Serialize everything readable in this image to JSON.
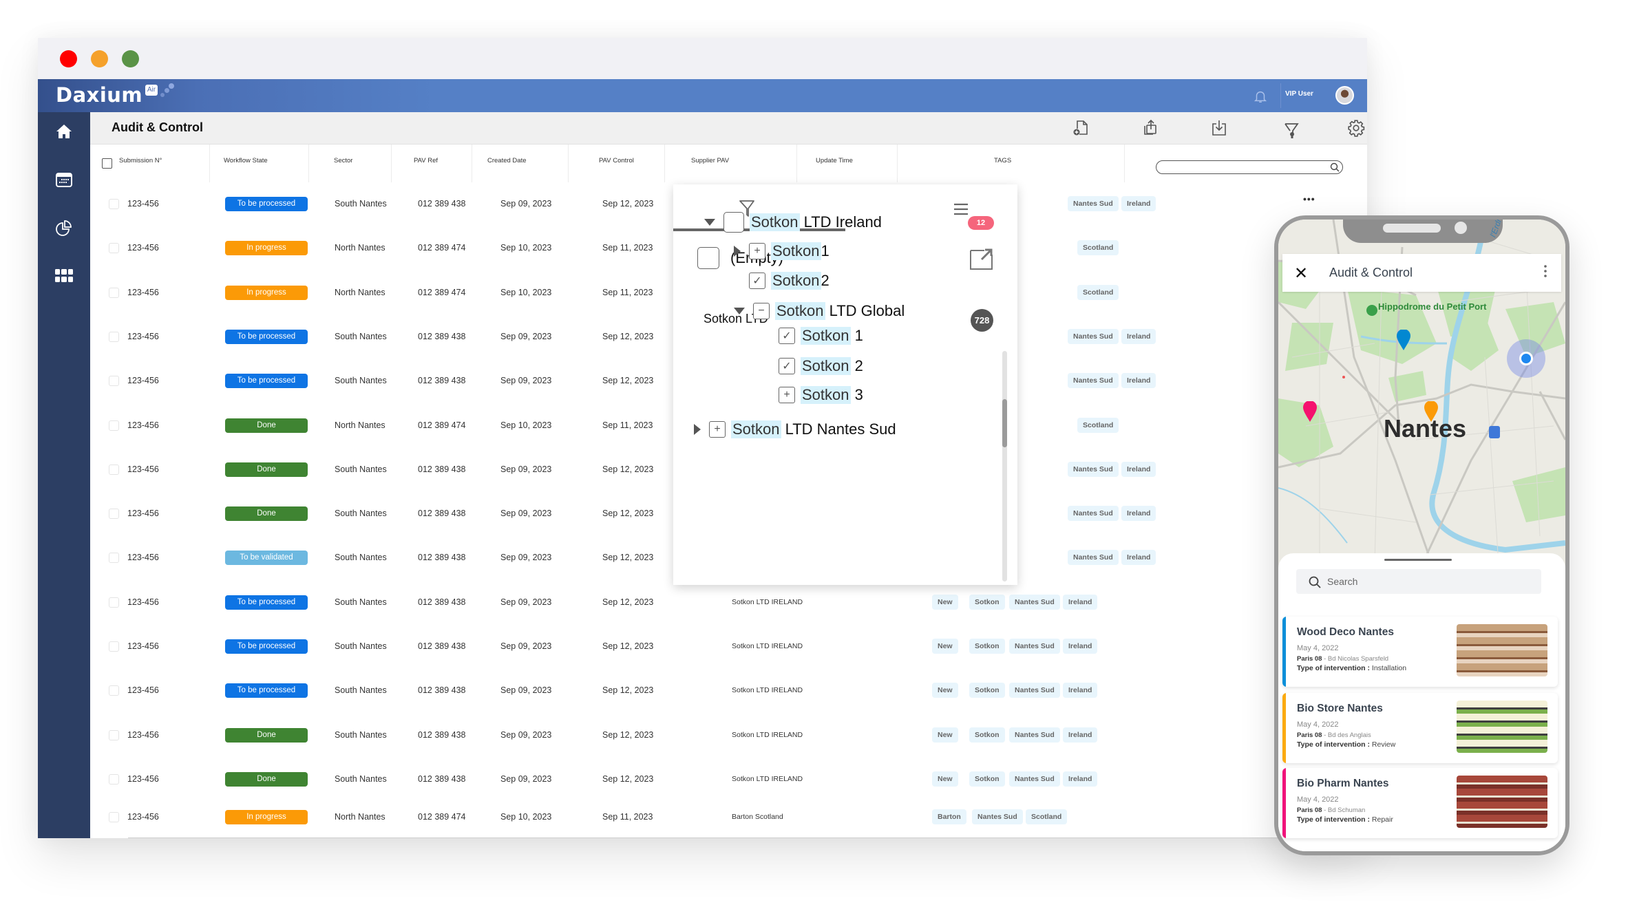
{
  "window": {
    "traffic_lights": [
      {
        "name": "close",
        "color": "#ff0000"
      },
      {
        "name": "minimize",
        "color": "#f5a12b"
      },
      {
        "name": "maximize",
        "color": "#5a9347"
      }
    ]
  },
  "app": {
    "brand": "Daxium",
    "brand_badge": "Air",
    "user_name": "VIP User",
    "header_color": "#5580c6",
    "sidebar_color": "#2c3e63"
  },
  "sidebar": {
    "items": [
      {
        "icon": "home-icon",
        "label": "Home"
      },
      {
        "icon": "calendar-icon",
        "label": "Calendar"
      },
      {
        "icon": "pie-chart-icon",
        "label": "Reports"
      },
      {
        "icon": "apps-grid-icon",
        "label": "Apps"
      }
    ]
  },
  "toolbar": {
    "title": "Audit & Control",
    "actions": [
      {
        "icon": "new-document-icon",
        "label": "New document"
      },
      {
        "icon": "export-icon",
        "label": "Export"
      },
      {
        "icon": "download-icon",
        "label": "Download"
      },
      {
        "icon": "filter-icon",
        "label": "Filter"
      },
      {
        "icon": "settings-icon",
        "label": "Settings"
      }
    ]
  },
  "table": {
    "columns": [
      "Submission N°",
      "Workflow State",
      "Sector",
      "PAV Ref",
      "Created Date",
      "PAV Control",
      "Supplier PAV",
      "Update Time",
      "TAGS"
    ],
    "search_value": "",
    "row_menu": "•••",
    "status_colors": {
      "To be processed": "#0e74e4",
      "In progress": "#fb9a07",
      "Done": "#3f8432",
      "To be validated": "#6cb8e0"
    },
    "rows": [
      {
        "id": "123-456",
        "state": "To be processed",
        "sector": "South Nantes",
        "pav_ref": "012 389 438",
        "created": "Sep 09, 2023",
        "control": "Sep 12, 2023",
        "supplier": "",
        "update": "",
        "tags": [
          "Nantes Sud",
          "Ireland"
        ]
      },
      {
        "id": "123-456",
        "state": "In progress",
        "sector": "North Nantes",
        "pav_ref": "012 389 474",
        "created": "Sep 10, 2023",
        "control": "Sep 11, 2023",
        "supplier": "",
        "update": "",
        "tags": [
          "Scotland"
        ]
      },
      {
        "id": "123-456",
        "state": "In progress",
        "sector": "North Nantes",
        "pav_ref": "012 389 474",
        "created": "Sep 10, 2023",
        "control": "Sep 11, 2023",
        "supplier": "",
        "update": "",
        "tags": [
          "Scotland"
        ]
      },
      {
        "id": "123-456",
        "state": "To be processed",
        "sector": "South Nantes",
        "pav_ref": "012 389 438",
        "created": "Sep 09, 2023",
        "control": "Sep 12, 2023",
        "supplier": "",
        "update": "",
        "tags": [
          "Nantes Sud",
          "Ireland"
        ]
      },
      {
        "id": "123-456",
        "state": "To be processed",
        "sector": "South Nantes",
        "pav_ref": "012 389 438",
        "created": "Sep 09, 2023",
        "control": "Sep 12, 2023",
        "supplier": "",
        "update": "",
        "tags": [
          "Nantes Sud",
          "Ireland"
        ]
      },
      {
        "id": "123-456",
        "state": "Done",
        "sector": "North Nantes",
        "pav_ref": "012 389 474",
        "created": "Sep 10, 2023",
        "control": "Sep 11, 2023",
        "supplier": "",
        "update": "",
        "tags": [
          "Scotland"
        ]
      },
      {
        "id": "123-456",
        "state": "Done",
        "sector": "South Nantes",
        "pav_ref": "012 389 438",
        "created": "Sep 09, 2023",
        "control": "Sep 12, 2023",
        "supplier": "",
        "update": "",
        "tags": [
          "Nantes Sud",
          "Ireland"
        ]
      },
      {
        "id": "123-456",
        "state": "Done",
        "sector": "South Nantes",
        "pav_ref": "012 389 438",
        "created": "Sep 09, 2023",
        "control": "Sep 12, 2023",
        "supplier": "",
        "update": "",
        "tags": [
          "Nantes Sud",
          "Ireland"
        ]
      },
      {
        "id": "123-456",
        "state": "To be validated",
        "sector": "South Nantes",
        "pav_ref": "012 389 438",
        "created": "Sep 09, 2023",
        "control": "Sep 12, 2023",
        "supplier": "",
        "update": "",
        "tags": [
          "Nantes Sud",
          "Ireland"
        ]
      },
      {
        "id": "123-456",
        "state": "To be processed",
        "sector": "South Nantes",
        "pav_ref": "012 389 438",
        "created": "Sep 09, 2023",
        "control": "Sep 12, 2023",
        "supplier": "Sotkon LTD IRELAND",
        "update": "",
        "tags": [
          "New",
          "Sotkon",
          "Nantes Sud",
          "Ireland"
        ]
      },
      {
        "id": "123-456",
        "state": "To be processed",
        "sector": "South Nantes",
        "pav_ref": "012 389 438",
        "created": "Sep 09, 2023",
        "control": "Sep 12, 2023",
        "supplier": "Sotkon LTD IRELAND",
        "update": "",
        "tags": [
          "New",
          "Sotkon",
          "Nantes Sud",
          "Ireland"
        ]
      },
      {
        "id": "123-456",
        "state": "To be processed",
        "sector": "South Nantes",
        "pav_ref": "012 389 438",
        "created": "Sep 09, 2023",
        "control": "Sep 12, 2023",
        "supplier": "Sotkon LTD IRELAND",
        "update": "",
        "tags": [
          "New",
          "Sotkon",
          "Nantes Sud",
          "Ireland"
        ]
      },
      {
        "id": "123-456",
        "state": "Done",
        "sector": "South Nantes",
        "pav_ref": "012 389 438",
        "created": "Sep 09, 2023",
        "control": "Sep 12, 2023",
        "supplier": "Sotkon LTD IRELAND",
        "update": "",
        "tags": [
          "New",
          "Sotkon",
          "Nantes Sud",
          "Ireland"
        ]
      },
      {
        "id": "123-456",
        "state": "Done",
        "sector": "South Nantes",
        "pav_ref": "012 389 438",
        "created": "Sep 09, 2023",
        "control": "Sep 12, 2023",
        "supplier": "Sotkon LTD IRELAND",
        "update": "",
        "tags": [
          "New",
          "Sotkon",
          "Nantes Sud",
          "Ireland"
        ]
      },
      {
        "id": "123-456",
        "state": "In progress",
        "sector": "North Nantes",
        "pav_ref": "012 389 474",
        "created": "Sep 10, 2023",
        "control": "Sep 11, 2023",
        "supplier": "Barton Scotland",
        "update": "",
        "tags": [
          "Barton",
          "Nantes Sud",
          "Scotland"
        ]
      }
    ]
  },
  "filter_panel": {
    "empty_label": "(Empty)",
    "group_label": "Sotkon LTD",
    "group_count": "728",
    "highlight_term": "Sotkon",
    "tree": [
      {
        "label_hl": "Sotkon",
        "label_rest": " LTD Ireland",
        "level": 0,
        "state": "unchecked",
        "expander": "expanded",
        "count": "12"
      },
      {
        "label_hl": "Sotkon",
        "label_rest": "1",
        "level": 1,
        "state": "partial-plus",
        "expander": "collapsed"
      },
      {
        "label_hl": "Sotkon",
        "label_rest": "2",
        "level": 1,
        "state": "checked",
        "expander": "none"
      },
      {
        "label_hl": "Sotkon",
        "label_rest": " LTD Global",
        "level": 1,
        "state": "partial-minus",
        "expander": "expanded"
      },
      {
        "label_hl": "Sotkon",
        "label_rest": " 1",
        "level": 2,
        "state": "checked",
        "expander": "none"
      },
      {
        "label_hl": "Sotkon",
        "label_rest": " 2",
        "level": 2,
        "state": "checked",
        "expander": "none"
      },
      {
        "label_hl": "Sotkon",
        "label_rest": " 3",
        "level": 2,
        "state": "partial-plus",
        "expander": "none"
      },
      {
        "label_hl": "Sotkon",
        "label_rest": " LTD Nantes Sud",
        "level": 0,
        "state": "partial-plus",
        "expander": "collapsed"
      }
    ]
  },
  "mobile": {
    "title": "Audit & Control",
    "map": {
      "city_label": "Nantes",
      "poi_label": "Hippodrome du Petit Port",
      "river_label": "l'Erdre",
      "pins": [
        {
          "color": "#0288d1"
        },
        {
          "color": "#fb9a07"
        },
        {
          "color": "#f5126e"
        }
      ]
    },
    "search_placeholder": "Search",
    "cards": [
      {
        "title": "Wood Deco Nantes",
        "date": "May 4, 2022",
        "city": "Paris 08",
        "address": "Bd Nicolas Sparsfeld",
        "type_label": "Type of intervention :",
        "type": "Installation",
        "color": "#0a8fd9"
      },
      {
        "title": "Bio Store Nantes",
        "date": "May 4, 2022",
        "city": "Paris 08",
        "address": "Bd des Anglais",
        "type_label": "Type of intervention :",
        "type": "Review",
        "color": "#fbaa10"
      },
      {
        "title": "Bio Pharm Nantes",
        "date": "May 4, 2022",
        "city": "Paris 08",
        "address": "Bd Schuman",
        "type_label": "Type of intervention :",
        "type": "Repair",
        "color": "#f0127a"
      }
    ]
  }
}
